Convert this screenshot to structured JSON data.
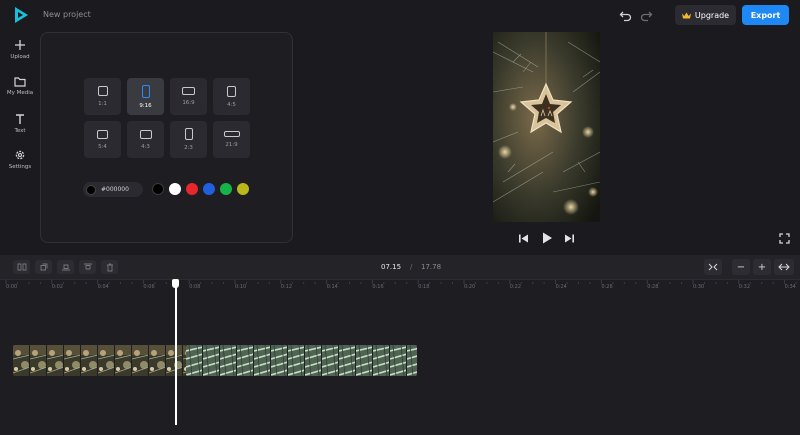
{
  "app": {
    "project_name": "New project",
    "upgrade_label": "Upgrade",
    "export_label": "Export",
    "accent_color": "#1e88f5"
  },
  "sidebar": {
    "items": [
      {
        "label": "Upload",
        "icon": "plus-icon"
      },
      {
        "label": "My Media",
        "icon": "folder-icon"
      },
      {
        "label": "Text",
        "icon": "text-icon"
      },
      {
        "label": "Settings",
        "icon": "gear-icon"
      }
    ]
  },
  "format_panel": {
    "ratios": [
      {
        "label": "1:1"
      },
      {
        "label": "9:16",
        "selected": true
      },
      {
        "label": "16:9"
      },
      {
        "label": "4:5"
      },
      {
        "label": "5:4"
      },
      {
        "label": "4:3"
      },
      {
        "label": "2:3"
      },
      {
        "label": "21:9"
      }
    ],
    "background_color_value": "#000000",
    "swatches": [
      "#000000",
      "#ffffff",
      "#e8262d",
      "#1f5fe0",
      "#17b24a",
      "#b8b81a"
    ]
  },
  "preview": {
    "controls": [
      "skip-back-icon",
      "play-icon",
      "skip-forward-icon",
      "fullscreen-icon"
    ]
  },
  "timeline": {
    "current_time": "07.15",
    "separator": "/",
    "total_time": "17.78",
    "ruler_labels": [
      "0:00",
      "0:02",
      "0:04",
      "0:06",
      "0:08",
      "0:10",
      "0:12",
      "0:14",
      "0:16",
      "0:18",
      "0:20",
      "0:22",
      "0:24",
      "0:26",
      "0:28",
      "0:30",
      "0:32",
      "0:34"
    ],
    "zoom_minus": "−",
    "zoom_plus": "+"
  }
}
